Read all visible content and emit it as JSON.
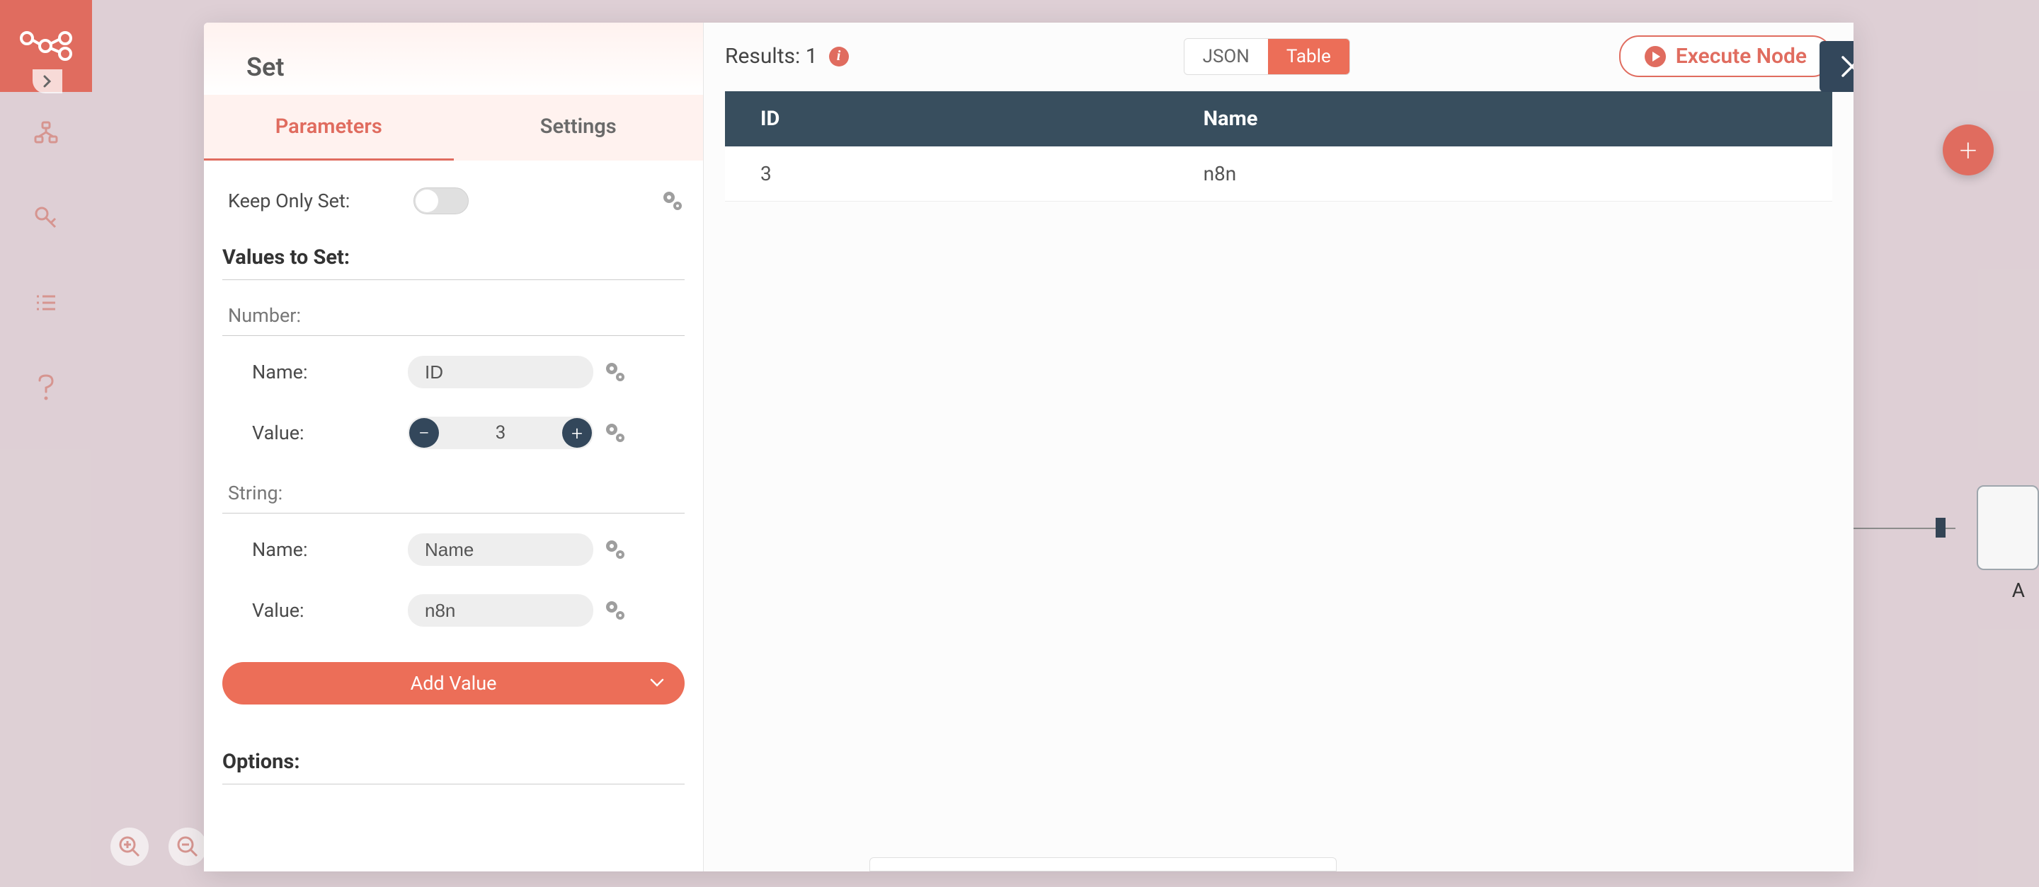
{
  "node": {
    "title": "Set",
    "tabs": {
      "parameters": "Parameters",
      "settings": "Settings"
    },
    "params": {
      "keep_only_set_label": "Keep Only Set:",
      "values_to_set_label": "Values to Set:",
      "options_label": "Options:",
      "number_header": "Number:",
      "string_header": "String:",
      "name_label": "Name:",
      "value_label": "Value:",
      "number_name": "ID",
      "number_value": "3",
      "string_name": "Name",
      "string_value": "n8n",
      "add_value_label": "Add Value"
    }
  },
  "results": {
    "label": "Results: 1",
    "json_tab": "JSON",
    "table_tab": "Table",
    "execute_label": "Execute Node",
    "columns": [
      "ID",
      "Name"
    ],
    "rows": [
      {
        "id": "3",
        "name": "n8n"
      }
    ]
  },
  "canvas": {
    "node_label": "A"
  },
  "icons": {
    "plus": "+",
    "minus": "−"
  }
}
